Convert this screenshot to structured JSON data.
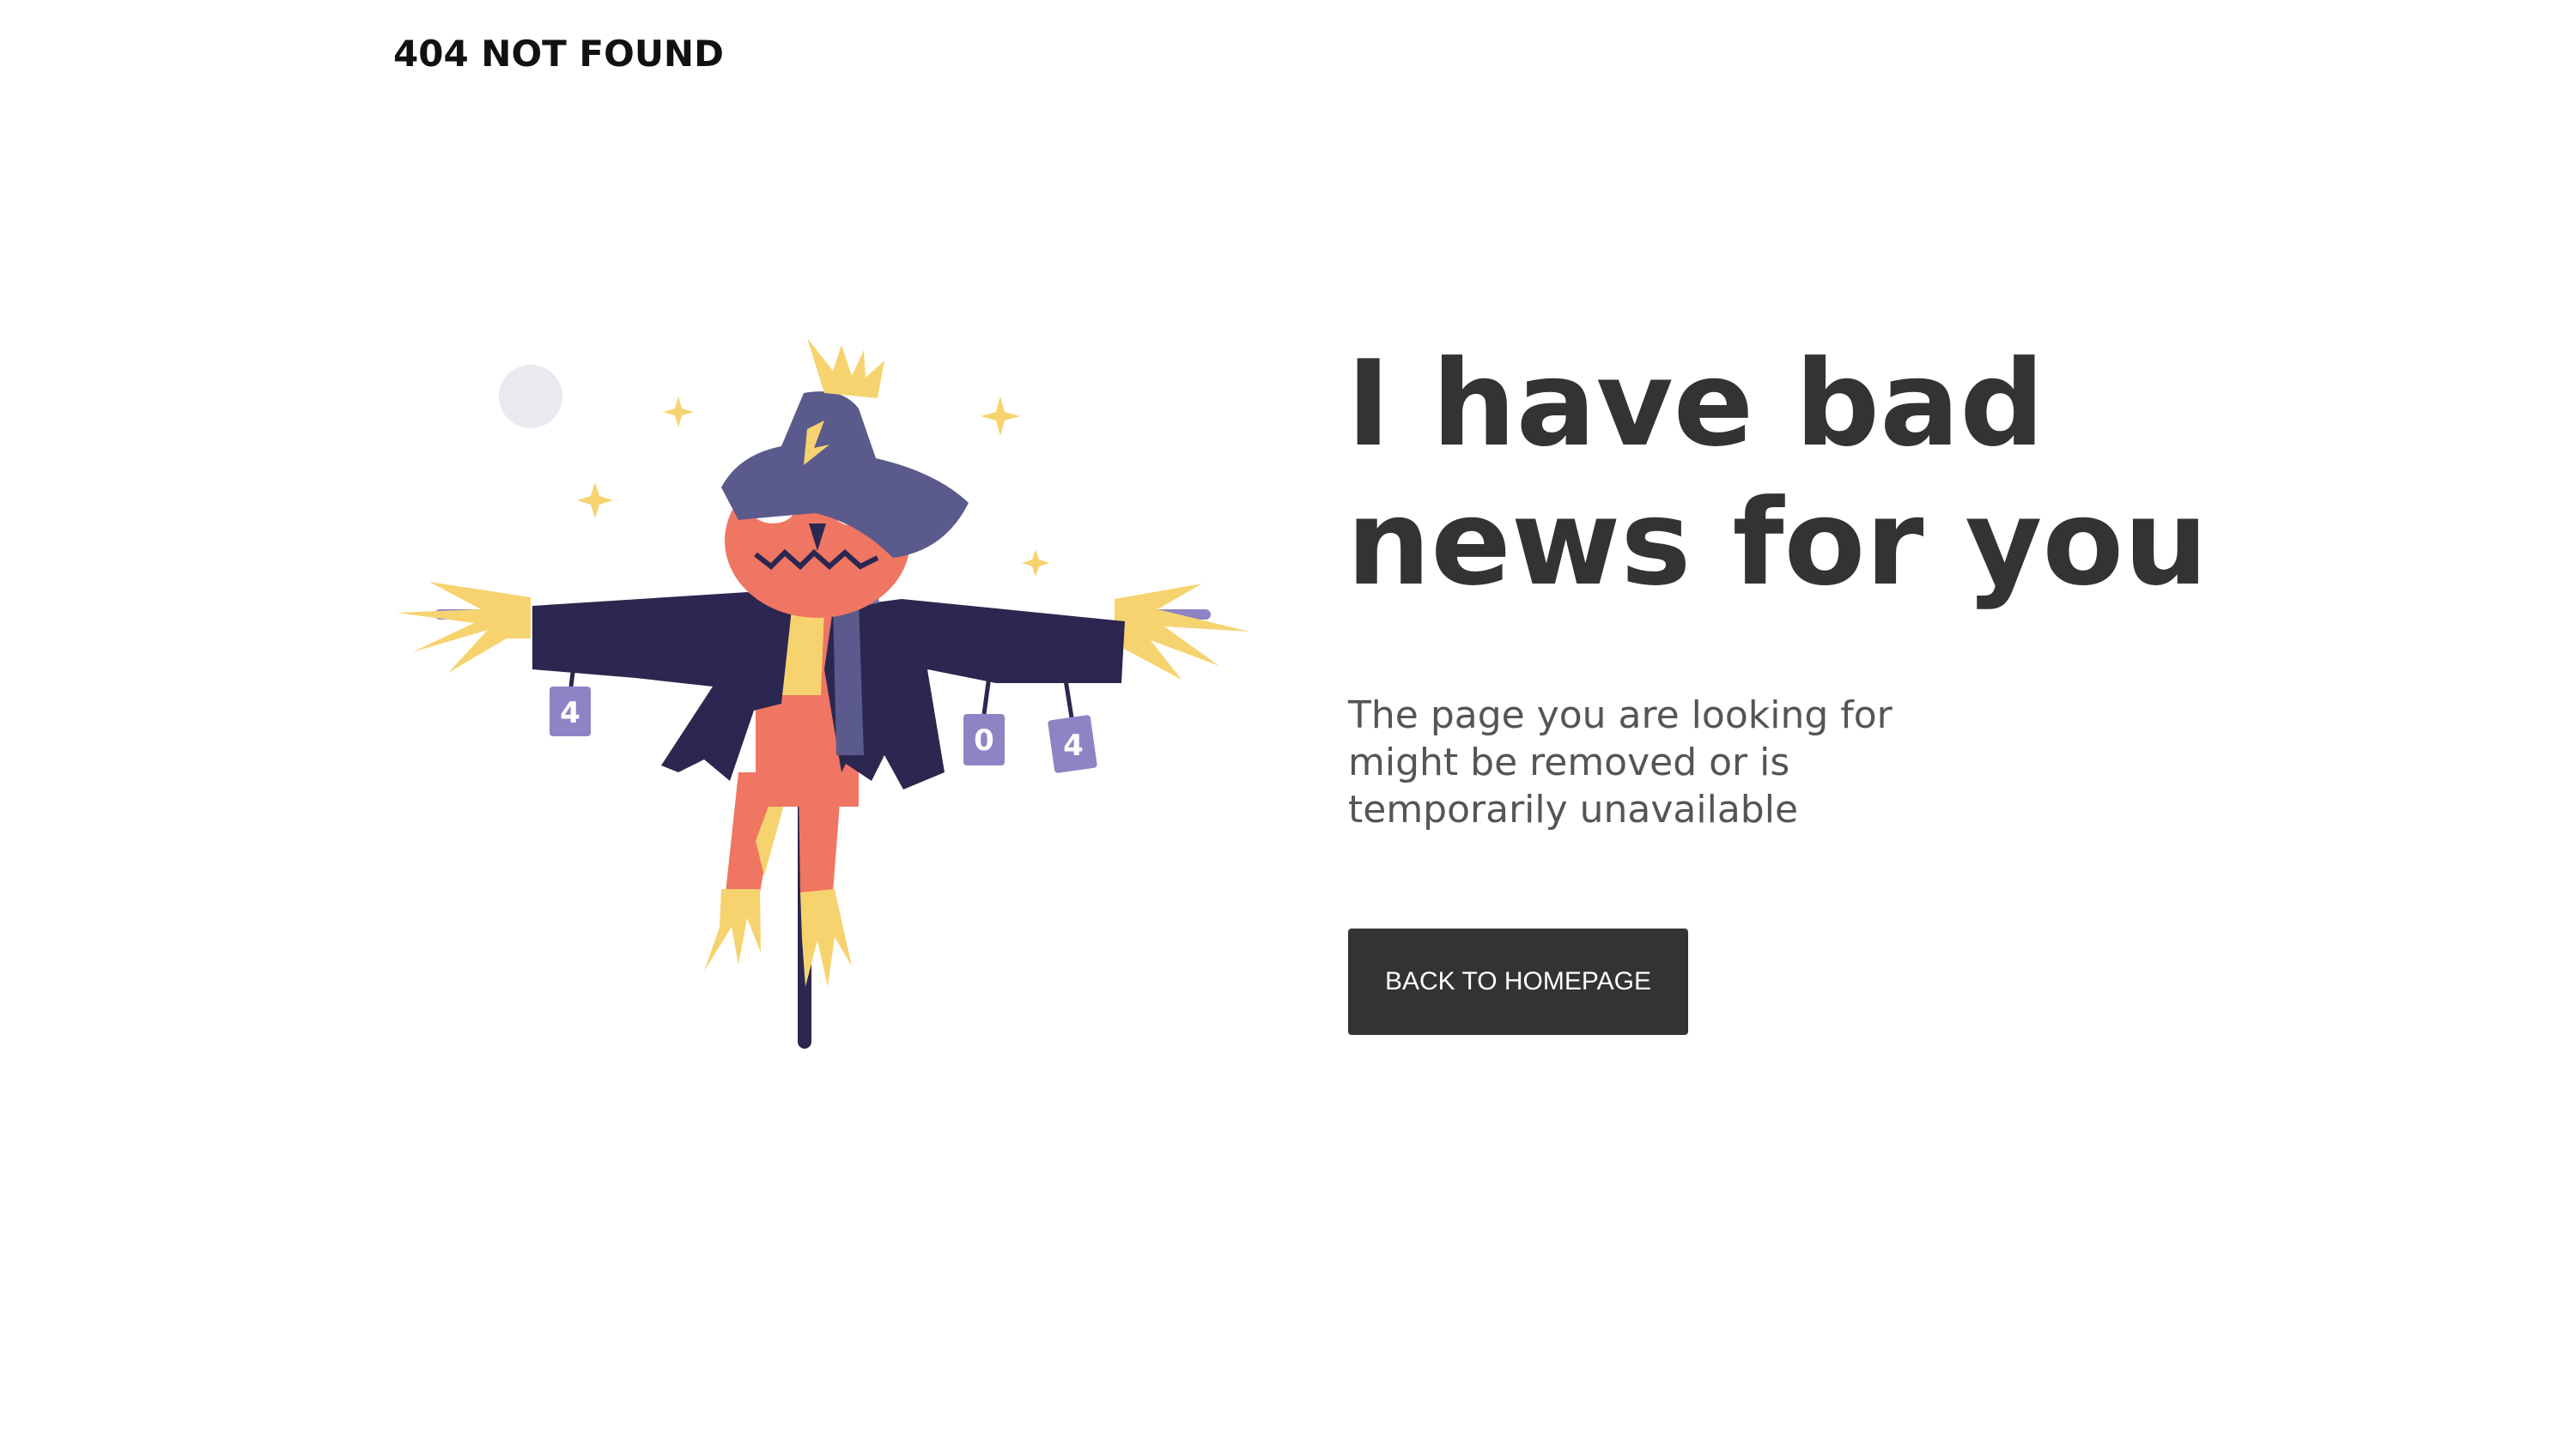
{
  "header": {
    "brand": "404 NOT FOUND"
  },
  "main": {
    "headline": "I have bad news for you",
    "message": "The page you are looking for might be removed or is temporarily unavailable",
    "button_label": "BACK TO HOMEPAGE"
  },
  "illustration": {
    "subject": "scarecrow-illustration",
    "can_labels": [
      "4",
      "0",
      "4"
    ]
  },
  "colors": {
    "text_dark": "#333333",
    "button_bg": "#333333",
    "button_text": "#ffffff",
    "hat": "#5b5a8c",
    "coat": "#2b2750",
    "pumpkin": "#ef7662",
    "straw": "#f6d36f",
    "scarf": "#7a70ad",
    "moon": "#e8eaef"
  }
}
